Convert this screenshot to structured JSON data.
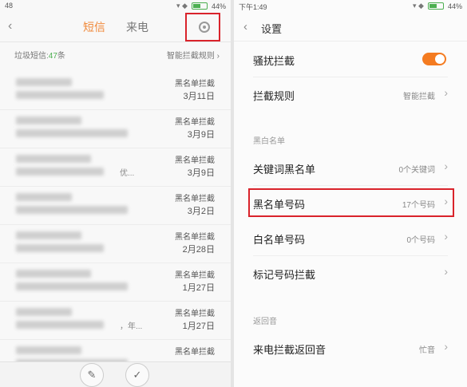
{
  "left_panel": {
    "status_time": "48",
    "battery": "44%",
    "tabs": {
      "sms": "短信",
      "calls": "来电"
    },
    "spam": {
      "label": "垃圾短信:",
      "count": "47",
      "unit": "条",
      "rules_link": "智能拦截规则"
    },
    "messages": [
      {
        "tag": "黑名单拦截",
        "date": "3月11日",
        "snippet": ""
      },
      {
        "tag": "黑名单拦截",
        "date": "3月9日",
        "snippet": ""
      },
      {
        "tag": "黑名单拦截",
        "date": "3月9日",
        "snippet": "优..."
      },
      {
        "tag": "黑名单拦截",
        "date": "3月2日",
        "snippet": ""
      },
      {
        "tag": "黑名单拦截",
        "date": "2月28日",
        "snippet": ""
      },
      {
        "tag": "黑名单拦截",
        "date": "1月27日",
        "snippet": ""
      },
      {
        "tag": "黑名单拦截",
        "date": "1月27日",
        "snippet": "，年..."
      },
      {
        "tag": "黑名单拦截",
        "date": "",
        "snippet": ""
      }
    ],
    "bottom": {
      "edit_icon": "edit-icon",
      "check_icon": "check-icon"
    }
  },
  "right_panel": {
    "status_time": "下午1:49",
    "battery": "44%",
    "header": {
      "title": "设置"
    },
    "rows": {
      "harass": {
        "label": "骚扰拦截",
        "toggle_on": true
      },
      "rules": {
        "label": "拦截规则",
        "value": "智能拦截"
      },
      "section_blackwhite": "黑白名单",
      "keyword": {
        "label": "关键词黑名单",
        "value": "0个关键词"
      },
      "blacklist": {
        "label": "黑名单号码",
        "value": "17个号码"
      },
      "whitelist": {
        "label": "白名单号码",
        "value": "0个号码"
      },
      "mark": {
        "label": "标记号码拦截",
        "value": ""
      },
      "section_return": "返回音",
      "return_tone": {
        "label": "来电拦截返回音",
        "value": "忙音"
      }
    }
  },
  "colors": {
    "accent": "#f47b20",
    "highlight_box": "#d9232b",
    "spam_count": "#4caf50"
  }
}
